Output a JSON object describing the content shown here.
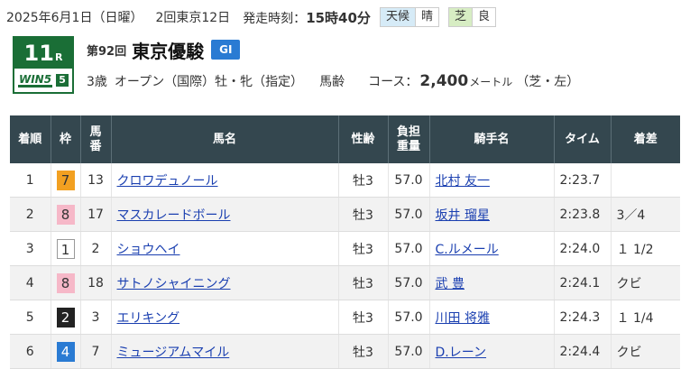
{
  "header": {
    "date": "2025年6月1日（日曜）",
    "meeting": "2回東京12日",
    "post_label": "発走時刻：",
    "post_time": "15時40分",
    "weather_label": "天候",
    "weather": "晴",
    "surface_label": "芝",
    "going": "良"
  },
  "race": {
    "number": "11",
    "number_suffix": "R",
    "win5_text": "WIN5",
    "win5_leg": "5",
    "edition": "第92回",
    "name": "東京優駿",
    "grade": "GI",
    "condition_age": "3歳",
    "condition_class": "オープン（国際）牡・牝（指定）",
    "weight_rule": "馬齢",
    "course_label": "コース：",
    "distance": "2,400",
    "distance_unit": "メートル",
    "course_detail": "（芝・左）"
  },
  "colors": {
    "header_bg": "#34474f",
    "badge_green": "#1a6e36",
    "grade_blue": "#2a7bd3",
    "link": "#1a3fb0"
  },
  "table": {
    "headers": {
      "rank": "着順",
      "frame": "枠",
      "num": "馬番",
      "horse": "馬名",
      "sexage": "性齢",
      "weight": "負担重量",
      "jockey": "騎手名",
      "time": "タイム",
      "margin": "着差"
    },
    "rows": [
      {
        "rank": "1",
        "frame": "7",
        "num": "13",
        "horse": "クロワデュノール",
        "sexage": "牡3",
        "weight": "57.0",
        "jockey": "北村 友一",
        "time": "2:23.7",
        "margin": ""
      },
      {
        "rank": "2",
        "frame": "8",
        "num": "17",
        "horse": "マスカレードボール",
        "sexage": "牡3",
        "weight": "57.0",
        "jockey": "坂井 瑠星",
        "time": "2:23.8",
        "margin": "3／4"
      },
      {
        "rank": "3",
        "frame": "1",
        "num": "2",
        "horse": "ショウヘイ",
        "sexage": "牡3",
        "weight": "57.0",
        "jockey": "C.ルメール",
        "time": "2:24.0",
        "margin": "１ 1/2"
      },
      {
        "rank": "4",
        "frame": "8",
        "num": "18",
        "horse": "サトノシャイニング",
        "sexage": "牡3",
        "weight": "57.0",
        "jockey": "武 豊",
        "time": "2:24.1",
        "margin": "クビ"
      },
      {
        "rank": "5",
        "frame": "2",
        "num": "3",
        "horse": "エリキング",
        "sexage": "牡3",
        "weight": "57.0",
        "jockey": "川田 将雅",
        "time": "2:24.3",
        "margin": "１ 1/4"
      },
      {
        "rank": "6",
        "frame": "4",
        "num": "7",
        "horse": "ミュージアムマイル",
        "sexage": "牡3",
        "weight": "57.0",
        "jockey": "D.レーン",
        "time": "2:24.4",
        "margin": "クビ"
      }
    ]
  }
}
